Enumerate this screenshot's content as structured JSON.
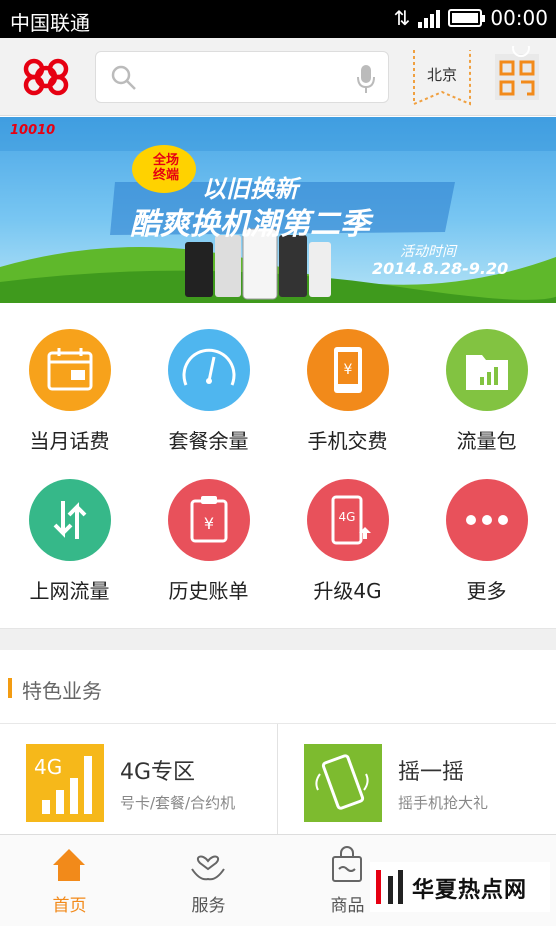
{
  "status": {
    "carrier": "中国联通",
    "time": "00:00"
  },
  "search": {
    "placeholder": ""
  },
  "city": "北京",
  "banner": {
    "brand": "10010",
    "badge": "全场\n终端",
    "headline1": "以旧换新",
    "headline2": "酷爽换机潮第二季",
    "date_label": "活动时间",
    "date_range": "2014.8.28-9.20"
  },
  "grid": [
    {
      "label": "当月话费",
      "color": "#f7a21b",
      "icon": "calendar-icon"
    },
    {
      "label": "套餐余量",
      "color": "#4fb6ef",
      "icon": "gauge-icon"
    },
    {
      "label": "手机交费",
      "color": "#f28a1a",
      "icon": "phone-yuan-icon"
    },
    {
      "label": "流量包",
      "color": "#82c341",
      "icon": "folder-chart-icon"
    },
    {
      "label": "上网流量",
      "color": "#36b889",
      "icon": "up-down-arrows-icon"
    },
    {
      "label": "历史账单",
      "color": "#e8515b",
      "icon": "clipboard-yuan-icon"
    },
    {
      "label": "升级4G",
      "color": "#e8515b",
      "icon": "phone-4g-upgrade-icon"
    },
    {
      "label": "更多",
      "color": "#e8515b",
      "icon": "more-dots-icon"
    }
  ],
  "section_title": "特色业务",
  "cards": [
    {
      "title": "4G专区",
      "subtitle": "号卡/套餐/合约机",
      "icon_text": "4G",
      "color": "#f6b81a"
    },
    {
      "title": "摇一摇",
      "subtitle": "摇手机抢大礼",
      "color": "#7dbb2f"
    }
  ],
  "tabs": [
    {
      "label": "首页",
      "active": true
    },
    {
      "label": "服务",
      "active": false
    },
    {
      "label": "商品",
      "active": false
    },
    {
      "label": "",
      "active": false
    }
  ],
  "watermark": "华夏热点网"
}
